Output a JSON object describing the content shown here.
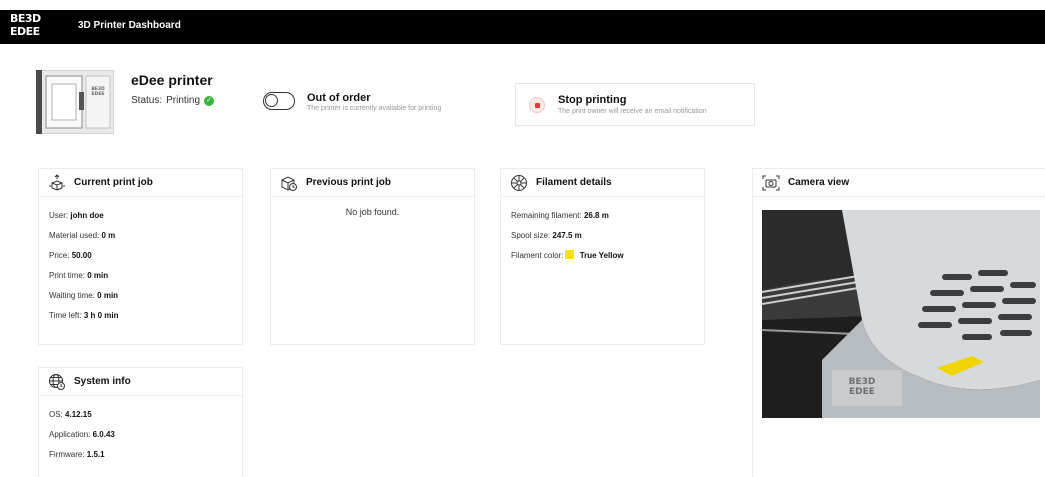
{
  "header": {
    "logo": [
      "BE3D",
      "EDEE"
    ],
    "title": "3D Printer Dashboard"
  },
  "printer": {
    "name": "eDee printer",
    "status_label": "Status:",
    "status_value": "Printing",
    "image_logo": [
      "BE3D",
      "EDEE"
    ]
  },
  "out_of_order": {
    "label": "Out of order",
    "description": "The printer is currently available for printing",
    "enabled": false
  },
  "stop_printing": {
    "label": "Stop printing",
    "description": "The print owner will receive an email notification"
  },
  "current_job": {
    "title": "Current print job",
    "icon": "box-arrows-icon",
    "fields": [
      {
        "label": "User:",
        "value": "john doe"
      },
      {
        "label": "Material used:",
        "value": "0 m"
      },
      {
        "label": "Price:",
        "value": "50.00"
      },
      {
        "label": "Print time:",
        "value": "0 min"
      },
      {
        "label": "Waiting time:",
        "value": "0 min"
      },
      {
        "label": "Time left:",
        "value": "3 h 0 min"
      }
    ]
  },
  "previous_job": {
    "title": "Previous print job",
    "icon": "box-clock-icon",
    "empty_text": "No job found."
  },
  "filament": {
    "title": "Filament details",
    "icon": "spool-icon",
    "remaining_label": "Remaining filament:",
    "remaining_value": "26.8 m",
    "spool_label": "Spool size:",
    "spool_value": "247.5 m",
    "color_label": "Filament color:",
    "color_value": "True Yellow",
    "color_hex": "#f7e21a"
  },
  "camera": {
    "title": "Camera view",
    "icon": "camera-icon"
  },
  "system": {
    "title": "System info",
    "icon": "globe-clock-icon",
    "fields": [
      {
        "label": "OS:",
        "value": "4.12.15"
      },
      {
        "label": "Application:",
        "value": "6.0.43"
      },
      {
        "label": "Firmware:",
        "value": "1.5.1"
      }
    ]
  },
  "colors": {
    "topbar": "#000000",
    "status_ok": "#3cb43c",
    "stop_red": "#e53935"
  }
}
